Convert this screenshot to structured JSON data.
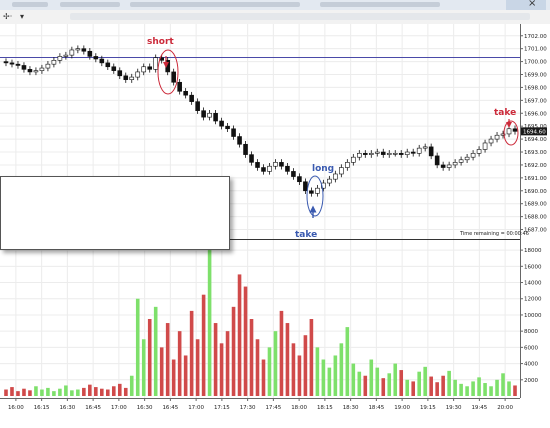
{
  "window": {
    "close_glyph": "×"
  },
  "toolbar": {
    "crosshair_glyph": "✢·",
    "dropdown_glyph": "▾"
  },
  "price_axis": {
    "ticks": [
      "1702.00",
      "1701.00",
      "1700.00",
      "1699.00",
      "1698.00",
      "1697.00",
      "1696.00",
      "1695.00",
      "1694.00",
      "1693.00",
      "1692.00",
      "1691.00",
      "1690.00",
      "1689.00",
      "1688.00",
      "1687.00"
    ],
    "last_price": "1694.60"
  },
  "volume_axis": {
    "ticks": [
      "18000",
      "16000",
      "14000",
      "12000",
      "10000",
      "8000",
      "6000",
      "4000",
      "2000"
    ]
  },
  "time_axis": {
    "ticks": [
      "16:00",
      "16:15",
      "16:30",
      "16:45",
      "17:00",
      "16:30",
      "16:45",
      "17:00",
      "17:15",
      "17:30",
      "17:45",
      "18:00",
      "18:15",
      "18:30",
      "18:45",
      "19:00",
      "19:15",
      "19:30",
      "19:45",
      "20:00"
    ]
  },
  "status": {
    "time_remaining": "Time remaining = 00:00:46"
  },
  "annotations": {
    "short": "short",
    "long": "long",
    "take_low": "take",
    "take_high": "take"
  },
  "colors": {
    "up_volume": "#7ee06b",
    "down_volume": "#d04a4a",
    "annotation_red": "#cc2a3a",
    "annotation_blue": "#3a5ab0",
    "level_line": "#4a4aa8"
  },
  "chart_data": {
    "type": "candlestick",
    "price_ylim": [
      1686.5,
      1702.6
    ],
    "volume_ylim": [
      0,
      19000
    ],
    "close": [
      1699.9,
      1699.8,
      1699.7,
      1699.4,
      1699.2,
      1699.3,
      1699.5,
      1699.8,
      1700.1,
      1700.4,
      1700.5,
      1700.9,
      1701.0,
      1700.8,
      1700.4,
      1700.2,
      1699.9,
      1699.6,
      1699.3,
      1698.9,
      1698.6,
      1698.8,
      1699.2,
      1699.6,
      1699.4,
      1700.3,
      1700.1,
      1699.2,
      1698.4,
      1697.7,
      1697.4,
      1696.9,
      1696.2,
      1695.7,
      1696.0,
      1695.4,
      1695.0,
      1694.8,
      1694.2,
      1693.6,
      1692.8,
      1692.2,
      1691.8,
      1691.5,
      1691.9,
      1692.2,
      1691.9,
      1691.5,
      1691.1,
      1690.7,
      1690.0,
      1689.8,
      1690.2,
      1690.6,
      1690.9,
      1691.3,
      1691.8,
      1692.2,
      1692.6,
      1692.9,
      1692.8,
      1692.9,
      1693.0,
      1692.8,
      1692.9,
      1692.9,
      1692.8,
      1693.0,
      1692.9,
      1693.3,
      1693.4,
      1692.7,
      1692.0,
      1691.8,
      1692.0,
      1692.2,
      1692.4,
      1692.6,
      1692.9,
      1693.2,
      1693.7,
      1694.0,
      1694.3,
      1694.4,
      1694.8,
      1694.6
    ],
    "volume": [
      800,
      1100,
      600,
      900,
      700,
      1200,
      800,
      1000,
      600,
      900,
      1300,
      700,
      800,
      1000,
      1400,
      1100,
      900,
      800,
      1200,
      1500,
      1000,
      2500,
      12000,
      7000,
      9500,
      11000,
      6000,
      9000,
      4500,
      8000,
      5000,
      10500,
      7000,
      12500,
      18800,
      9000,
      6500,
      8000,
      11000,
      15000,
      13500,
      9500,
      7000,
      4500,
      6000,
      8000,
      10500,
      9000,
      6500,
      5000,
      7500,
      9500,
      6000,
      4500,
      3500,
      5000,
      6500,
      8500,
      4000,
      3000,
      2500,
      4500,
      3500,
      2200,
      2800,
      4000,
      3200,
      2000,
      1800,
      3000,
      3600,
      2400,
      1700,
      2500,
      3100,
      2000,
      1500,
      1200,
      1800,
      2300,
      1600,
      1200,
      2000,
      2800,
      1800,
      1300
    ]
  }
}
